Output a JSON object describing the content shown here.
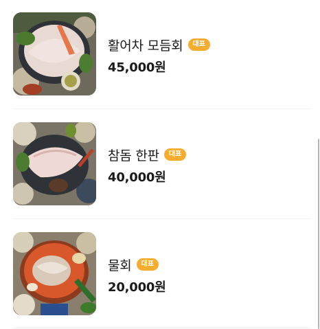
{
  "menu": {
    "items": [
      {
        "name": "활어차 모듬회",
        "badge": "대표",
        "price": "45,000원",
        "image": "sliced-raw-fish-platter"
      },
      {
        "name": "참돔 한판",
        "badge": "대표",
        "price": "40,000원",
        "image": "red-snapper-sashimi-platter"
      },
      {
        "name": "물회",
        "badge": "대표",
        "price": "20,000원",
        "image": "cold-spicy-raw-fish-soup"
      }
    ]
  },
  "colors": {
    "badge": "#f6ad2f",
    "text": "#1a1a1a",
    "divider": "#eeeeee"
  }
}
